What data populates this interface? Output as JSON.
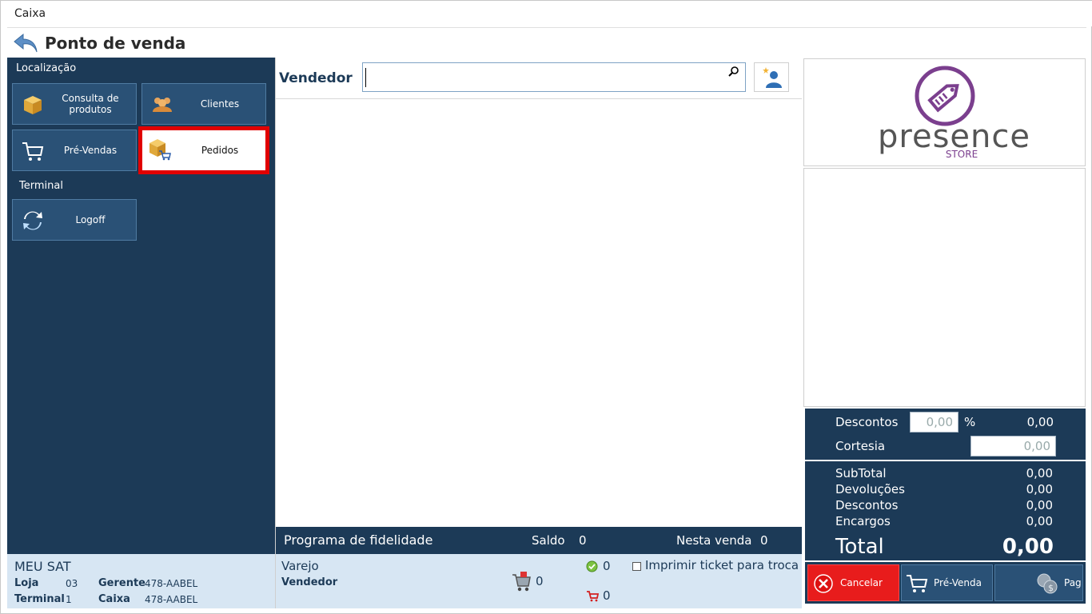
{
  "window": {
    "title": "Caixa"
  },
  "header": {
    "title": "Ponto de venda"
  },
  "sidebar": {
    "section_location": "Localização",
    "btn_consulta": "Consulta de produtos",
    "btn_clientes": "Clientes",
    "btn_prevendas": "Pré-Vendas",
    "btn_pedidos": "Pedidos",
    "section_terminal": "Terminal",
    "btn_logoff": "Logoff"
  },
  "status": {
    "sat": "MEU SAT",
    "loja_label": "Loja",
    "loja_value": "03",
    "gerente_label": "Gerente",
    "gerente_value": "478-AABEL",
    "terminal_label": "Terminal",
    "terminal_value": "1",
    "caixa_label": "Caixa",
    "caixa_value": "478-AABEL"
  },
  "vendedor": {
    "label": "Vendedor",
    "value": ""
  },
  "fidelidade": {
    "title": "Programa de fidelidade",
    "saldo_label": "Saldo",
    "saldo_value": "0",
    "nesta_label": "Nesta venda",
    "nesta_value": "0"
  },
  "info": {
    "tipo": "Varejo",
    "vendedor_label": "Vendedor",
    "cart_count": "0",
    "ok_count": "0",
    "cart2_count": "0",
    "print_ticket": "Imprimir ticket para troca"
  },
  "logo": {
    "name": "presence",
    "sub": "STORE",
    "color": "#7b3f8e"
  },
  "discounts": {
    "descontos_label": "Descontos",
    "descontos_input": "0,00",
    "percent": "%",
    "descontos_value": "0,00",
    "cortesia_label": "Cortesia",
    "cortesia_input": "0,00"
  },
  "totals": {
    "subtotal_label": "SubTotal",
    "subtotal": "0,00",
    "devolucoes_label": "Devoluções",
    "devolucoes": "0,00",
    "descontos_label": "Descontos",
    "descontos": "0,00",
    "encargos_label": "Encargos",
    "encargos": "0,00",
    "total_label": "Total",
    "total": "0,00"
  },
  "actions": {
    "cancel": "Cancelar",
    "prevenda": "Pré-Venda",
    "pag": "Pag"
  },
  "colors": {
    "navy": "#1c3a57",
    "tile": "#2a5176",
    "light": "#d7e6f3",
    "cancel": "#e81c1c",
    "highlight": "#e10000"
  }
}
